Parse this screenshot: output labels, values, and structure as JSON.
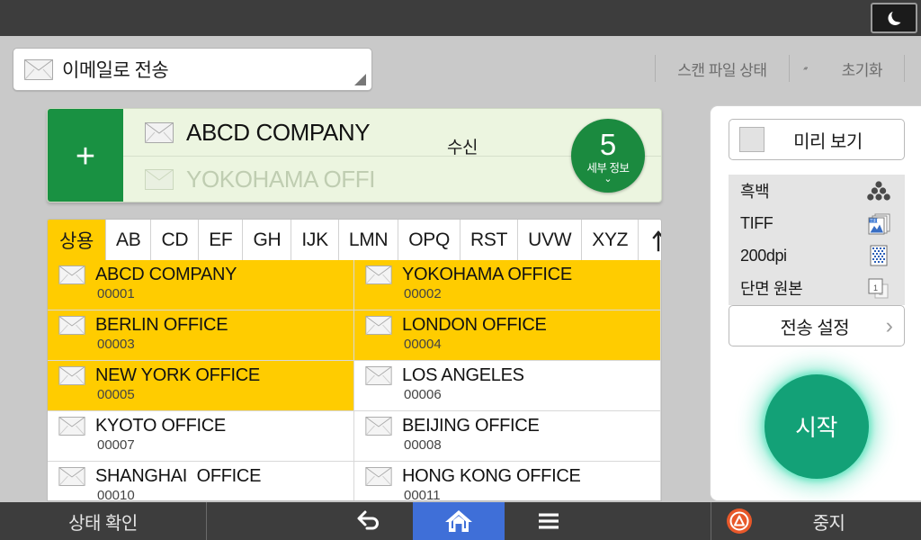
{
  "topbar": {
    "sleep_button_icon": "moon-icon"
  },
  "header": {
    "mode": {
      "label": "이메일로 전송",
      "icon": "envelope-icon"
    },
    "actions": {
      "scan_file_status": "스캔 파일 상태",
      "slash_icon": "triple-slash-icon",
      "reset": "초기화"
    }
  },
  "destination": {
    "add_label": "+",
    "to_label": "수신",
    "count": "5",
    "detail_label": "세부 정보",
    "chevron": "⌄",
    "rows": [
      {
        "name": "ABCD COMPANY"
      },
      {
        "name": "YOKOHAMA OFFI"
      }
    ]
  },
  "tabs": {
    "items": [
      {
        "label": "상용",
        "active": true
      },
      {
        "label": "AB",
        "active": false
      },
      {
        "label": "CD",
        "active": false
      },
      {
        "label": "EF",
        "active": false
      },
      {
        "label": "GH",
        "active": false
      },
      {
        "label": "IJK",
        "active": false
      },
      {
        "label": "LMN",
        "active": false
      },
      {
        "label": "OPQ",
        "active": false
      },
      {
        "label": "RST",
        "active": false
      },
      {
        "label": "UVW",
        "active": false
      },
      {
        "label": "XYZ",
        "active": false
      }
    ],
    "sort_icon": "sort-swap-icon"
  },
  "contacts": [
    {
      "name": "ABCD COMPANY",
      "number": "00001",
      "selected": true
    },
    {
      "name": "YOKOHAMA OFFICE",
      "number": "00002",
      "selected": true
    },
    {
      "name": "BERLIN OFFICE",
      "number": "00003",
      "selected": true
    },
    {
      "name": "LONDON OFFICE",
      "number": "00004",
      "selected": true
    },
    {
      "name": "NEW YORK OFFICE",
      "number": "00005",
      "selected": true
    },
    {
      "name": "LOS ANGELES",
      "number": "00006",
      "selected": false
    },
    {
      "name": "KYOTO OFFICE",
      "number": "00007",
      "selected": false
    },
    {
      "name": "BEIJING OFFICE",
      "number": "00008",
      "selected": false
    },
    {
      "name": "SHANGHAI  OFFICE",
      "number": "00010",
      "selected": false
    },
    {
      "name": "HONG KONG OFFICE",
      "number": "00011",
      "selected": false
    }
  ],
  "right_panel": {
    "preview": {
      "label": "미리 보기",
      "checked": false
    },
    "settings": [
      {
        "label": "흑백",
        "icon": "color-dots-icon"
      },
      {
        "label": "TIFF",
        "icon": "tiff-file-icon"
      },
      {
        "label": "200dpi",
        "icon": "resolution-grid-icon"
      },
      {
        "label": "단면 원본",
        "icon": "single-sided-original-icon"
      }
    ],
    "send_settings": {
      "label": "전송 설정",
      "arrow": "›"
    },
    "start_button": {
      "label": "시작"
    }
  },
  "bottombar": {
    "status_check": "상태 확인",
    "back_icon": "back-arrow-icon",
    "home_icon": "home-icon",
    "menu_icon": "hamburger-menu-icon",
    "stop_icon": "stop-icon",
    "stop_label": "중지"
  },
  "colors": {
    "accent_yellow": "#ffcc00",
    "green_banner": "#ecf5e0",
    "green_dark": "#199142",
    "start_teal": "#13a177",
    "home_blue": "#3f6fd8",
    "stop_orange": "#e8582a",
    "bar_dark": "#3d3d3d"
  }
}
